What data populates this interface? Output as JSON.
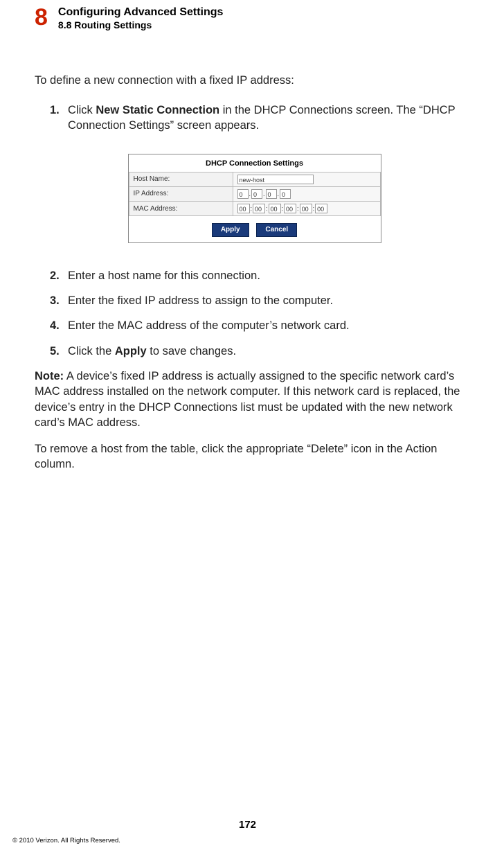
{
  "header": {
    "chapter_number": "8",
    "chapter_title": "Configuring Advanced Settings",
    "section_title": "8.8 Routing Settings"
  },
  "intro": "To define a new connection with a fixed IP address:",
  "steps": {
    "s1_num": "1.",
    "s1_pre": "Click ",
    "s1_bold": "New Static Connection",
    "s1_post": " in the DHCP Connections screen. The “DHCP Connection Settings” screen appears.",
    "s2_num": "2.",
    "s2_txt": "Enter a host name for this connection.",
    "s3_num": "3.",
    "s3_txt": "Enter the fixed IP address to assign to the computer.",
    "s4_num": "4.",
    "s4_txt": "Enter the MAC address of the computer’s network card.",
    "s5_num": "5.",
    "s5_pre": "Click the ",
    "s5_bold": "Apply",
    "s5_post": " to save changes."
  },
  "figure": {
    "title": "DHCP Connection Settings",
    "row1_label": "Host Name:",
    "row1_value": "new-host",
    "row2_label": "IP Address:",
    "ip": {
      "o1": "0",
      "o2": "0",
      "o3": "0",
      "o4": "0"
    },
    "row3_label": "MAC Address:",
    "mac": {
      "m1": "00",
      "m2": "00",
      "m3": "00",
      "m4": "00",
      "m5": "00",
      "m6": "00"
    },
    "sep": ":",
    "dot": ".",
    "btn_apply": "Apply",
    "btn_cancel": "Cancel"
  },
  "note": {
    "label": "Note:",
    "text": " A device’s fixed IP address is actually assigned to the specific network card’s MAC address installed on the network computer. If this network card is replaced, the device’s entry in the DHCP Connections list must be updated with the new network card’s MAC address."
  },
  "remove_text": "To remove a host from the table, click the appropriate “Delete” icon in the Action column.",
  "footer": {
    "page_number": "172",
    "copyright": "© 2010 Verizon. All Rights Reserved."
  }
}
